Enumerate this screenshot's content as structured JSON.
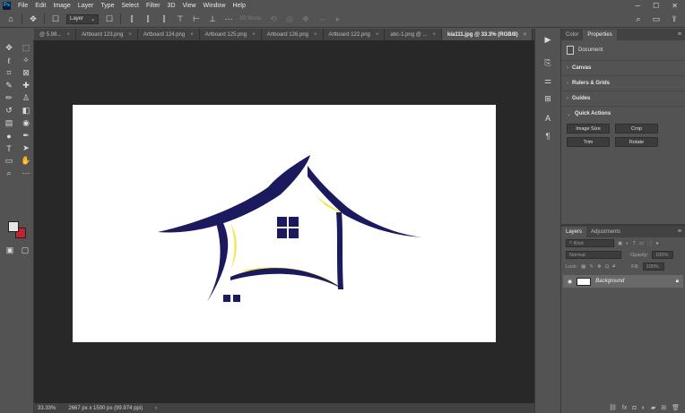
{
  "app": {
    "logo": "Ps"
  },
  "menubar": {
    "items": [
      "File",
      "Edit",
      "Image",
      "Layer",
      "Type",
      "Select",
      "Filter",
      "3D",
      "View",
      "Window",
      "Help"
    ]
  },
  "window_controls": {
    "minimize": "─",
    "maximize": "☐",
    "close": "✕"
  },
  "options_bar": {
    "layer_select": "Layer",
    "mode_3d": "3D Mode:"
  },
  "tabs": [
    {
      "label": "@ 5.98...",
      "active": false
    },
    {
      "label": "Artboard 123.png",
      "active": false
    },
    {
      "label": "Artboard 124.png",
      "active": false
    },
    {
      "label": "Artboard 125.png",
      "active": false
    },
    {
      "label": "Artboard 126.png",
      "active": false
    },
    {
      "label": "Artboard 122.png",
      "active": false
    },
    {
      "label": "abc-1.png @ ...",
      "active": false
    },
    {
      "label": "kia111.jpg @ 33.3% (RGB/8)",
      "active": true
    }
  ],
  "status": {
    "zoom": "33.33%",
    "doc_size": "2667 px x 1500 px (99.974 ppi)"
  },
  "colors": {
    "foreground": "#e6e6e6",
    "background": "#c0242e",
    "logo_navy": "#1c1a5e",
    "logo_yellow": "#f2e646"
  },
  "properties_panel": {
    "tabs": [
      "Color",
      "Properties"
    ],
    "active_tab": "Properties",
    "doc_label": "Document",
    "sections": [
      "Canvas",
      "Rulers & Grids",
      "Guides",
      "Quick Actions"
    ],
    "quick_actions": [
      "Image Size",
      "Crop",
      "Trim",
      "Rotate"
    ]
  },
  "layers_panel": {
    "tabs": [
      "Layers",
      "Adjustments"
    ],
    "active_tab": "Layers",
    "kind_placeholder": "Kind",
    "blend_mode": "Normal",
    "opacity_label": "Opacity:",
    "opacity_value": "100%",
    "lock_label": "Lock:",
    "fill_label": "Fill:",
    "fill_value": "100%",
    "layers": [
      {
        "name": "Background",
        "visible": true,
        "locked": true
      }
    ]
  }
}
